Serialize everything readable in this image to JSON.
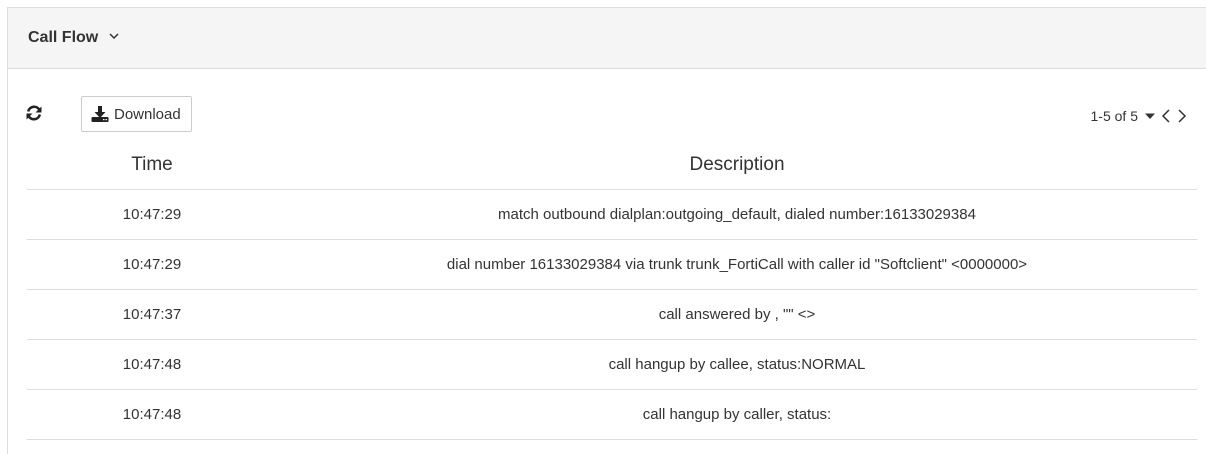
{
  "panel": {
    "title": "Call Flow"
  },
  "toolbar": {
    "download_label": "Download"
  },
  "pager": {
    "range_text": "1-5 of 5"
  },
  "table": {
    "columns": [
      "Time",
      "Description"
    ],
    "rows": [
      {
        "time": "10:47:29",
        "description": "match outbound dialplan:outgoing_default, dialed number:16133029384"
      },
      {
        "time": "10:47:29",
        "description": "dial number 16133029384 via trunk trunk_FortiCall with caller id \"Softclient\" <0000000>"
      },
      {
        "time": "10:47:37",
        "description": "call answered by , \"\" <>"
      },
      {
        "time": "10:47:48",
        "description": "call hangup by callee, status:NORMAL"
      },
      {
        "time": "10:47:48",
        "description": "call hangup by caller, status:"
      }
    ]
  },
  "icons": {
    "refresh": "refresh-icon",
    "download": "download-icon",
    "chevron": "chevron-down-icon",
    "caret": "caret-down-icon",
    "prev": "chevron-left-icon",
    "next": "chevron-right-icon"
  },
  "colors": {
    "header_bg": "#f5f5f5",
    "border": "#dddddd",
    "text": "#333333"
  }
}
